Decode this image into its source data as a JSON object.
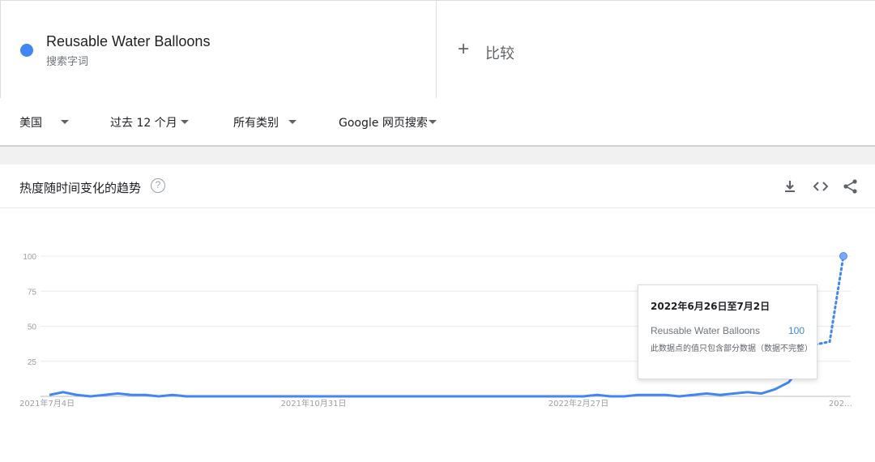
{
  "search_term": {
    "name": "Reusable Water Balloons",
    "subtitle": "搜索字词",
    "color": "#4285f4"
  },
  "compare": {
    "label": "比较",
    "icon": "plus-icon"
  },
  "filters": {
    "region": "美国",
    "time_range": "过去 12 个月",
    "category": "所有类别",
    "search_type": "Google 网页搜索"
  },
  "card": {
    "title": "热度随时间变化的趋势",
    "help_icon": "?",
    "tools": [
      "download-icon",
      "embed-icon",
      "share-icon"
    ]
  },
  "tooltip": {
    "date": "2022年6月26日至7月2日",
    "series": "Reusable Water Balloons",
    "value": "100",
    "note": "此数据点的值只包含部分数据（数据不完整）"
  },
  "chart_data": {
    "type": "line",
    "title": "热度随时间变化的趋势",
    "ylim": [
      0,
      100
    ],
    "y_ticks": [
      "25",
      "50",
      "75",
      "100"
    ],
    "x_labels": [
      "2021年7月4日",
      "2021年10月31日",
      "2022年2月27日",
      "202…"
    ],
    "grid": true,
    "series": [
      {
        "name": "Reusable Water Balloons",
        "color": "#4285f4",
        "values": [
          1,
          3,
          1,
          0,
          1,
          2,
          1,
          1,
          0,
          1,
          0,
          0,
          0,
          0,
          0,
          0,
          0,
          0,
          0,
          0,
          0,
          0,
          0,
          0,
          0,
          0,
          0,
          0,
          0,
          0,
          0,
          0,
          0,
          0,
          0,
          0,
          0,
          0,
          0,
          0,
          1,
          0,
          0,
          1,
          1,
          1,
          0,
          1,
          2,
          1,
          2,
          3,
          2,
          5,
          10,
          22,
          37,
          39,
          100
        ],
        "partial_points": 3
      }
    ]
  }
}
